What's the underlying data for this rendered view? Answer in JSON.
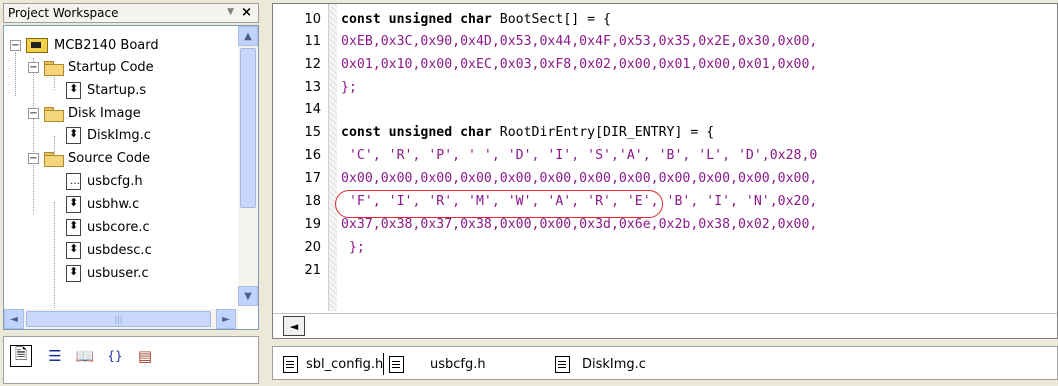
{
  "workspace": {
    "title": "Project Workspace",
    "pin_glyph": "▼",
    "close_glyph": "×",
    "tree": [
      {
        "label": "MCB2140 Board",
        "icon": "board-icon",
        "expander": "−"
      },
      {
        "label": "Startup Code",
        "icon": "folder-icon",
        "expander": "−"
      },
      {
        "label": "Startup.s",
        "icon": "source-file-icon"
      },
      {
        "label": "Disk Image",
        "icon": "folder-icon",
        "expander": "−"
      },
      {
        "label": "DiskImg.c",
        "icon": "source-file-icon"
      },
      {
        "label": "Source Code",
        "icon": "folder-icon",
        "expander": "−"
      },
      {
        "label": "usbcfg.h",
        "icon": "header-file-icon"
      },
      {
        "label": "usbhw.c",
        "icon": "source-file-icon"
      },
      {
        "label": "usbcore.c",
        "icon": "source-file-icon"
      },
      {
        "label": "usbdesc.c",
        "icon": "source-file-icon"
      },
      {
        "label": "usbuser.c",
        "icon": "source-file-icon"
      }
    ],
    "bottom_tabs": [
      "files-tab-icon",
      "regs-tab-icon",
      "books-tab-icon",
      "functions-tab-icon",
      "templates-tab-icon"
    ]
  },
  "editor": {
    "lines": [
      {
        "n": "10",
        "kw": "const unsigned char",
        "rest": " BootSect[] = {"
      },
      {
        "n": "11",
        "text": "0xEB,0x3C,0x90,0x4D,0x53,0x44,0x4F,0x53,0x35,0x2E,0x30,0x00,"
      },
      {
        "n": "12",
        "text": "0x01,0x10,0x00,0xEC,0x03,0xF8,0x02,0x00,0x01,0x00,0x01,0x00,"
      },
      {
        "n": "13",
        "text": "};"
      },
      {
        "n": "14",
        "text": ""
      },
      {
        "n": "15",
        "kw": "const unsigned char",
        "rest": " RootDirEntry[DIR_ENTRY] = {"
      },
      {
        "n": "16",
        "text": " 'C', 'R', 'P', ' ', 'D', 'I', 'S','A', 'B', 'L', 'D',0x28,0"
      },
      {
        "n": "17",
        "text": "0x00,0x00,0x00,0x00,0x00,0x00,0x00,0x00,0x00,0x00,0x00,0x00,"
      },
      {
        "n": "18",
        "text": " 'F', 'I', 'R', 'M', 'W', 'A', 'R', 'E', 'B', 'I', 'N',0x20,"
      },
      {
        "n": "19",
        "text": "0x37,0x38,0x37,0x38,0x00,0x00,0x3d,0x6e,0x2b,0x38,0x02,0x00,"
      },
      {
        "n": "20",
        "text": " };"
      },
      {
        "n": "21",
        "text": ""
      }
    ],
    "scroll_left_glyph": "◄"
  },
  "file_tabs": [
    {
      "label": "sbl_config.h"
    },
    {
      "label": "usbcfg.h"
    },
    {
      "label": "DiskImg.c",
      "active": true
    }
  ],
  "colors": {
    "literal": "#8b1a8b",
    "annotation_circle": "#e02a2a"
  }
}
